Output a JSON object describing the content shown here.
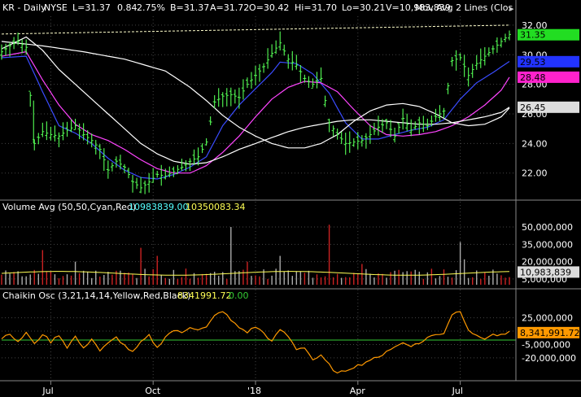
{
  "header": {
    "symbol": "KR - Daily",
    "exchange": "NYSE",
    "last": "L=31.37",
    "change": "0.84",
    "change_pct": "2.75%",
    "bid": "B=31.37",
    "ask": "A=31.72",
    "open": "O=30.42",
    "high": "Hi=31.70",
    "low": "Lo=30.21",
    "volume": "V=10,983,839",
    "study": "Mov Avg 2 Lines (Clos"
  },
  "volume_panel": {
    "label": "Volume Avg (50,50,Cyan,Red)",
    "avg_value": "10983839.00",
    "avg2_value": "10350083.34"
  },
  "chaikin_panel": {
    "label": "Chaikin Osc (3,21,14,14,Yellow,Red,Black)",
    "value": "8341991.72",
    "value2": "0.00"
  },
  "colors": {
    "background": "#000000",
    "price_up": "#55ff55",
    "price_down": "#55ff55",
    "ma_fast": "#3a4cff",
    "ma_mid": "#ff44ff",
    "ma_slow": "#ffffff",
    "ma_long": "#ffffff",
    "vol_up": "#aaaaaa",
    "vol_down": "#cc2222",
    "vol_avg": "#ffff55",
    "osc_line": "#ff9900",
    "osc_zero": "#33cc33",
    "grid": "#444444",
    "badge_last": "#22dd22",
    "badge_blue": "#2233ff",
    "badge_magenta": "#ff22cc",
    "badge_white": "#dddddd"
  },
  "chart_data": [
    {
      "type": "candlestick",
      "title": "KR - Daily",
      "ylim": [
        20.5,
        32.6
      ],
      "y_ticks": [
        22.0,
        24.0,
        26.0,
        28.0,
        30.0,
        32.0
      ],
      "x_ticks": [
        "Jul",
        "Oct",
        "'18",
        "Apr",
        "Jul"
      ],
      "x_tick_index": [
        12,
        37,
        62,
        87,
        112
      ],
      "price_anchors": [
        [
          0,
          30.2
        ],
        [
          2,
          30.6
        ],
        [
          4,
          30.9
        ],
        [
          6,
          30.5
        ],
        [
          8,
          24.0
        ],
        [
          10,
          24.8
        ],
        [
          12,
          24.6
        ],
        [
          14,
          24.5
        ],
        [
          16,
          24.9
        ],
        [
          18,
          25.2
        ],
        [
          20,
          24.6
        ],
        [
          22,
          24.2
        ],
        [
          24,
          23.6
        ],
        [
          26,
          22.2
        ],
        [
          28,
          22.8
        ],
        [
          30,
          22.4
        ],
        [
          32,
          21.4
        ],
        [
          34,
          21.0
        ],
        [
          36,
          21.4
        ],
        [
          38,
          21.9
        ],
        [
          40,
          21.8
        ],
        [
          42,
          22.1
        ],
        [
          44,
          22.4
        ],
        [
          46,
          22.8
        ],
        [
          48,
          23.1
        ],
        [
          50,
          24.1
        ],
        [
          52,
          26.8
        ],
        [
          54,
          27.2
        ],
        [
          56,
          27.3
        ],
        [
          58,
          27.1
        ],
        [
          60,
          28.0
        ],
        [
          62,
          28.6
        ],
        [
          64,
          29.2
        ],
        [
          66,
          30.1
        ],
        [
          68,
          30.8
        ],
        [
          70,
          29.7
        ],
        [
          72,
          29.3
        ],
        [
          74,
          28.4
        ],
        [
          76,
          28.0
        ],
        [
          78,
          28.4
        ],
        [
          80,
          25.4
        ],
        [
          82,
          24.6
        ],
        [
          84,
          24.0
        ],
        [
          86,
          24.1
        ],
        [
          88,
          24.2
        ],
        [
          90,
          24.6
        ],
        [
          92,
          25.1
        ],
        [
          94,
          25.4
        ],
        [
          96,
          24.5
        ],
        [
          98,
          25.7
        ],
        [
          100,
          24.9
        ],
        [
          102,
          25.4
        ],
        [
          104,
          25.2
        ],
        [
          106,
          25.8
        ],
        [
          108,
          26.2
        ],
        [
          110,
          29.6
        ],
        [
          112,
          29.8
        ],
        [
          114,
          28.6
        ],
        [
          116,
          29.4
        ],
        [
          118,
          29.9
        ],
        [
          120,
          30.4
        ],
        [
          122,
          30.9
        ],
        [
          124,
          31.37
        ]
      ],
      "moving_averages": [
        {
          "label": "fast",
          "color_key": "ma_fast",
          "points": [
            [
              0,
              29.8
            ],
            [
              6,
              29.9
            ],
            [
              10,
              27.5
            ],
            [
              14,
              25.2
            ],
            [
              18,
              24.7
            ],
            [
              22,
              24.0
            ],
            [
              26,
              23.0
            ],
            [
              30,
              22.2
            ],
            [
              34,
              21.7
            ],
            [
              38,
              21.6
            ],
            [
              42,
              21.9
            ],
            [
              46,
              22.4
            ],
            [
              50,
              23.1
            ],
            [
              54,
              25.2
            ],
            [
              58,
              26.6
            ],
            [
              62,
              27.7
            ],
            [
              66,
              28.8
            ],
            [
              68,
              29.5
            ],
            [
              72,
              29.4
            ],
            [
              76,
              28.7
            ],
            [
              80,
              27.4
            ],
            [
              84,
              25.4
            ],
            [
              88,
              24.3
            ],
            [
              92,
              24.3
            ],
            [
              96,
              24.6
            ],
            [
              100,
              24.9
            ],
            [
              104,
              25.1
            ],
            [
              108,
              25.6
            ],
            [
              112,
              27.0
            ],
            [
              116,
              28.1
            ],
            [
              120,
              28.8
            ],
            [
              124,
              29.55
            ]
          ]
        },
        {
          "label": "mid",
          "color_key": "ma_mid",
          "points": [
            [
              0,
              29.9
            ],
            [
              6,
              30.2
            ],
            [
              10,
              28.3
            ],
            [
              14,
              26.6
            ],
            [
              18,
              25.3
            ],
            [
              22,
              24.6
            ],
            [
              26,
              24.2
            ],
            [
              30,
              23.6
            ],
            [
              34,
              22.9
            ],
            [
              38,
              22.3
            ],
            [
              42,
              22.0
            ],
            [
              46,
              22.0
            ],
            [
              50,
              22.5
            ],
            [
              54,
              23.4
            ],
            [
              58,
              24.5
            ],
            [
              62,
              25.8
            ],
            [
              66,
              27.0
            ],
            [
              70,
              27.8
            ],
            [
              74,
              28.2
            ],
            [
              78,
              28.1
            ],
            [
              82,
              27.5
            ],
            [
              86,
              26.3
            ],
            [
              90,
              25.2
            ],
            [
              94,
              24.6
            ],
            [
              98,
              24.5
            ],
            [
              102,
              24.6
            ],
            [
              106,
              24.8
            ],
            [
              110,
              25.2
            ],
            [
              114,
              25.8
            ],
            [
              118,
              26.6
            ],
            [
              122,
              27.6
            ],
            [
              124,
              28.48
            ]
          ]
        },
        {
          "label": "slow",
          "color_key": "ma_slow",
          "points": [
            [
              0,
              30.4
            ],
            [
              6,
              31.2
            ],
            [
              10,
              30.3
            ],
            [
              14,
              29.0
            ],
            [
              18,
              28.0
            ],
            [
              22,
              27.0
            ],
            [
              26,
              26.0
            ],
            [
              30,
              25.0
            ],
            [
              34,
              24.0
            ],
            [
              38,
              23.3
            ],
            [
              42,
              22.8
            ],
            [
              46,
              22.6
            ],
            [
              50,
              22.7
            ],
            [
              54,
              23.1
            ],
            [
              58,
              23.6
            ],
            [
              62,
              24.0
            ],
            [
              66,
              24.4
            ],
            [
              70,
              24.8
            ],
            [
              74,
              25.1
            ],
            [
              78,
              25.3
            ],
            [
              82,
              25.5
            ],
            [
              86,
              25.6
            ],
            [
              90,
              25.6
            ],
            [
              94,
              25.5
            ],
            [
              98,
              25.4
            ],
            [
              102,
              25.3
            ],
            [
              106,
              25.3
            ],
            [
              110,
              25.4
            ],
            [
              114,
              25.6
            ],
            [
              118,
              25.8
            ],
            [
              122,
              26.1
            ],
            [
              124,
              26.45
            ]
          ]
        },
        {
          "label": "long",
          "color_key": "ma_long",
          "points": [
            [
              0,
              30.9
            ],
            [
              10,
              30.6
            ],
            [
              20,
              30.2
            ],
            [
              30,
              29.7
            ],
            [
              40,
              28.9
            ],
            [
              46,
              27.8
            ],
            [
              50,
              26.9
            ],
            [
              54,
              25.9
            ],
            [
              58,
              25.1
            ],
            [
              62,
              24.5
            ],
            [
              66,
              24.0
            ],
            [
              70,
              23.7
            ],
            [
              74,
              23.7
            ],
            [
              78,
              24.0
            ],
            [
              82,
              24.6
            ],
            [
              86,
              25.5
            ],
            [
              90,
              26.2
            ],
            [
              94,
              26.6
            ],
            [
              98,
              26.7
            ],
            [
              102,
              26.5
            ],
            [
              106,
              26.0
            ],
            [
              110,
              25.4
            ],
            [
              114,
              25.2
            ],
            [
              118,
              25.3
            ],
            [
              122,
              25.8
            ],
            [
              124,
              26.4
            ]
          ]
        }
      ],
      "resistance_line": [
        [
          0,
          31.4
        ],
        [
          124,
          32.0
        ]
      ],
      "value_badges": [
        {
          "label": "31.35",
          "y": 31.35,
          "color_key": "badge_last",
          "text_color": "#000000"
        },
        {
          "label": "29.53",
          "y": 29.53,
          "color_key": "badge_blue",
          "text_color": "#000000"
        },
        {
          "label": "28.48",
          "y": 28.48,
          "color_key": "badge_magenta",
          "text_color": "#000000"
        },
        {
          "label": "26.45",
          "y": 26.45,
          "color_key": "badge_white",
          "text_color": "#000000"
        }
      ]
    },
    {
      "type": "bar",
      "title": "Volume Avg (50,50,Cyan,Red)",
      "ylim": [
        0,
        62000000
      ],
      "y_ticks": [
        5000000,
        20000000,
        35000000,
        50000000
      ],
      "y_tick_labels": [
        "5,000,000",
        "20,000,000",
        "35,000,000",
        "50,000,000"
      ],
      "volume_avg": 10983839,
      "spikes": [
        {
          "i": 10,
          "v": 30000000,
          "down": true
        },
        {
          "i": 18,
          "v": 20000000,
          "down": false
        },
        {
          "i": 34,
          "v": 32000000,
          "down": true
        },
        {
          "i": 38,
          "v": 25000000,
          "down": true
        },
        {
          "i": 56,
          "v": 50000000,
          "down": false
        },
        {
          "i": 60,
          "v": 20000000,
          "down": true
        },
        {
          "i": 68,
          "v": 25000000,
          "down": false
        },
        {
          "i": 80,
          "v": 52000000,
          "down": true
        },
        {
          "i": 88,
          "v": 18000000,
          "down": true
        },
        {
          "i": 112,
          "v": 37000000,
          "down": false
        },
        {
          "i": 113,
          "v": 22000000,
          "down": false
        }
      ],
      "value_badges": [
        {
          "label": "10,983,839",
          "y": 10983839,
          "color_key": "badge_white",
          "text_color": "#000000"
        }
      ]
    },
    {
      "type": "line",
      "title": "Chaikin Osc (3,21,14,14,Yellow,Red,Black)",
      "ylim": [
        -42000000,
        42000000
      ],
      "y_ticks": [
        -20000000,
        -5000000,
        10000000,
        25000000
      ],
      "y_tick_labels": [
        "-20,000,000",
        "-5,000,000",
        "",
        "25,000,000"
      ],
      "zero": 0,
      "points": [
        [
          0,
          2000000
        ],
        [
          2,
          8000000
        ],
        [
          4,
          -3000000
        ],
        [
          6,
          9000000
        ],
        [
          8,
          -5000000
        ],
        [
          10,
          7000000
        ],
        [
          12,
          -2000000
        ],
        [
          14,
          6000000
        ],
        [
          16,
          -8000000
        ],
        [
          18,
          4000000
        ],
        [
          20,
          -10000000
        ],
        [
          22,
          2000000
        ],
        [
          24,
          -12000000
        ],
        [
          26,
          -4000000
        ],
        [
          28,
          3000000
        ],
        [
          30,
          -6000000
        ],
        [
          32,
          -14000000
        ],
        [
          34,
          -3000000
        ],
        [
          36,
          5000000
        ],
        [
          38,
          -9000000
        ],
        [
          40,
          4000000
        ],
        [
          42,
          11000000
        ],
        [
          44,
          8000000
        ],
        [
          46,
          15000000
        ],
        [
          48,
          12000000
        ],
        [
          50,
          14000000
        ],
        [
          52,
          27000000
        ],
        [
          54,
          33000000
        ],
        [
          56,
          22000000
        ],
        [
          58,
          14000000
        ],
        [
          60,
          9000000
        ],
        [
          62,
          15000000
        ],
        [
          64,
          8000000
        ],
        [
          66,
          -2000000
        ],
        [
          68,
          12000000
        ],
        [
          70,
          4000000
        ],
        [
          72,
          -10000000
        ],
        [
          74,
          -8000000
        ],
        [
          76,
          -22000000
        ],
        [
          78,
          -18000000
        ],
        [
          80,
          -28000000
        ],
        [
          82,
          -38000000
        ],
        [
          84,
          -34000000
        ],
        [
          86,
          -30000000
        ],
        [
          88,
          -27000000
        ],
        [
          90,
          -22000000
        ],
        [
          92,
          -20000000
        ],
        [
          94,
          -12000000
        ],
        [
          96,
          -8000000
        ],
        [
          98,
          -3000000
        ],
        [
          100,
          -6000000
        ],
        [
          102,
          -4000000
        ],
        [
          104,
          3000000
        ],
        [
          106,
          6000000
        ],
        [
          108,
          8000000
        ],
        [
          110,
          29000000
        ],
        [
          112,
          33000000
        ],
        [
          114,
          12000000
        ],
        [
          116,
          4000000
        ],
        [
          118,
          2000000
        ],
        [
          120,
          6000000
        ],
        [
          122,
          5000000
        ],
        [
          124,
          8341991
        ]
      ],
      "value_badges": [
        {
          "label": "8,341,991.72",
          "y": 8341991,
          "color_key": "osc_line",
          "text_color": "#000000"
        }
      ]
    }
  ]
}
